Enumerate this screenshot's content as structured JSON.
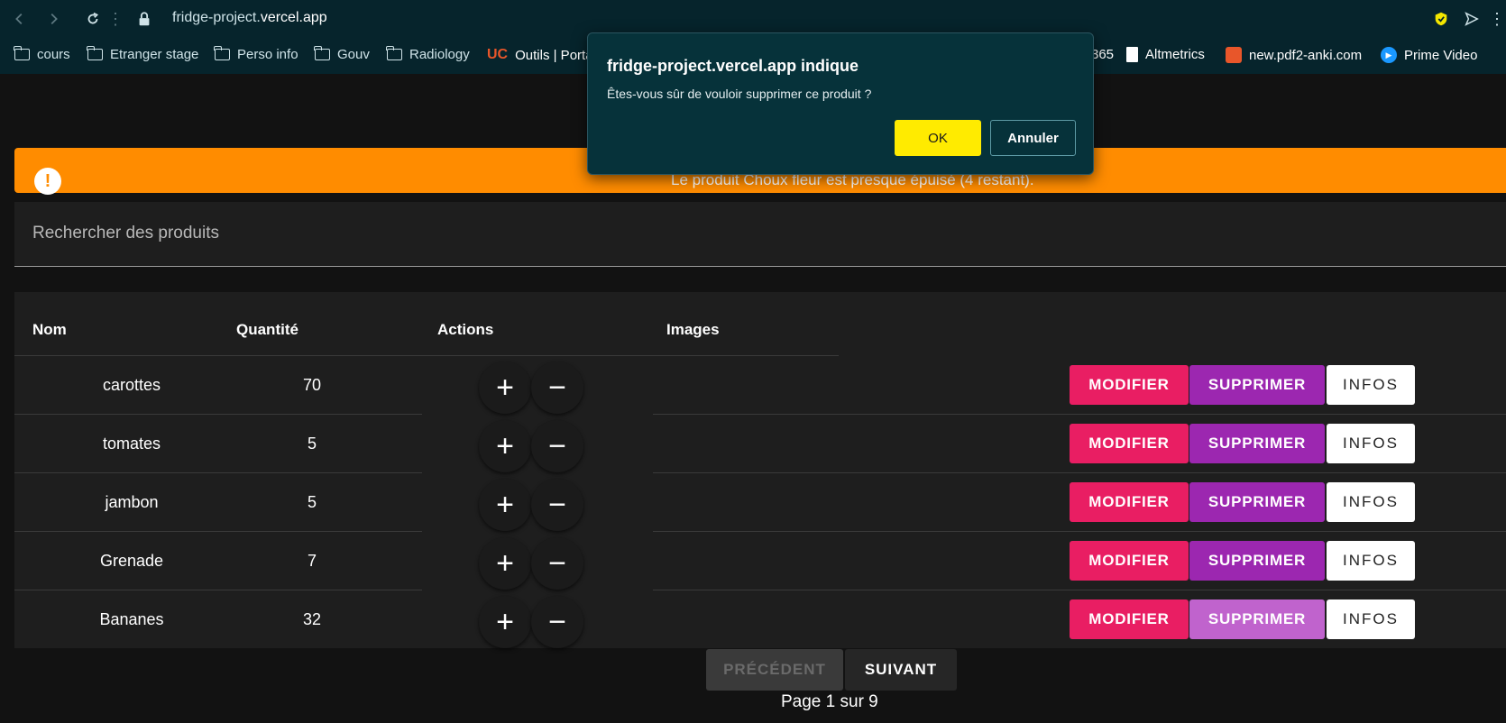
{
  "browser": {
    "url_host": "fridge-project.",
    "url_domain": "vercel.app",
    "bookmarks": [
      {
        "label": "cours",
        "icon": "folder-icon"
      },
      {
        "label": "Etranger stage",
        "icon": "folder-icon"
      },
      {
        "label": "Perso info",
        "icon": "folder-icon"
      },
      {
        "label": "Gouv",
        "icon": "folder-icon"
      },
      {
        "label": "Radiology",
        "icon": "folder-icon"
      },
      {
        "label": "Outils | Porta",
        "icon": "uc-logo-icon"
      },
      {
        "label": "365",
        "icon": ""
      },
      {
        "label": "Altmetrics",
        "icon": "document-icon"
      },
      {
        "label": "new.pdf2-anki.com",
        "icon": "pdf-icon"
      },
      {
        "label": "Prime Video",
        "icon": "play-icon"
      }
    ]
  },
  "alert": {
    "message": "Le produit Choux fleur est presque épuisé (4 restant).",
    "icon": "exclamation-icon"
  },
  "search": {
    "placeholder": "Rechercher des produits"
  },
  "table": {
    "headers": {
      "name": "Nom",
      "quantity": "Quantité",
      "actions": "Actions",
      "images": "Images"
    },
    "rows": [
      {
        "name": "carottes",
        "quantity": "70"
      },
      {
        "name": "tomates",
        "quantity": "5"
      },
      {
        "name": "jambon",
        "quantity": "5"
      },
      {
        "name": "Grenade",
        "quantity": "7"
      },
      {
        "name": "Bananes",
        "quantity": "32"
      }
    ],
    "plus_symbol": "+",
    "minus_symbol": "−",
    "modify_label": "MODIFIER",
    "delete_label": "SUPPRIMER",
    "info_label": "INFOS"
  },
  "pagination": {
    "prev_label": "PRÉCÉDENT",
    "next_label": "SUIVANT",
    "page_info": "Page 1 sur 9"
  },
  "dialog": {
    "title": "fridge-project.vercel.app indique",
    "message": "Êtes-vous sûr de vouloir supprimer ce produit ?",
    "ok_label": "OK",
    "cancel_label": "Annuler"
  },
  "colors": {
    "alert_bg": "#ff8c00",
    "modify_bg": "#e91e63",
    "delete_bg": "#9c27b0",
    "dialog_ok_bg": "#ffeb00"
  }
}
